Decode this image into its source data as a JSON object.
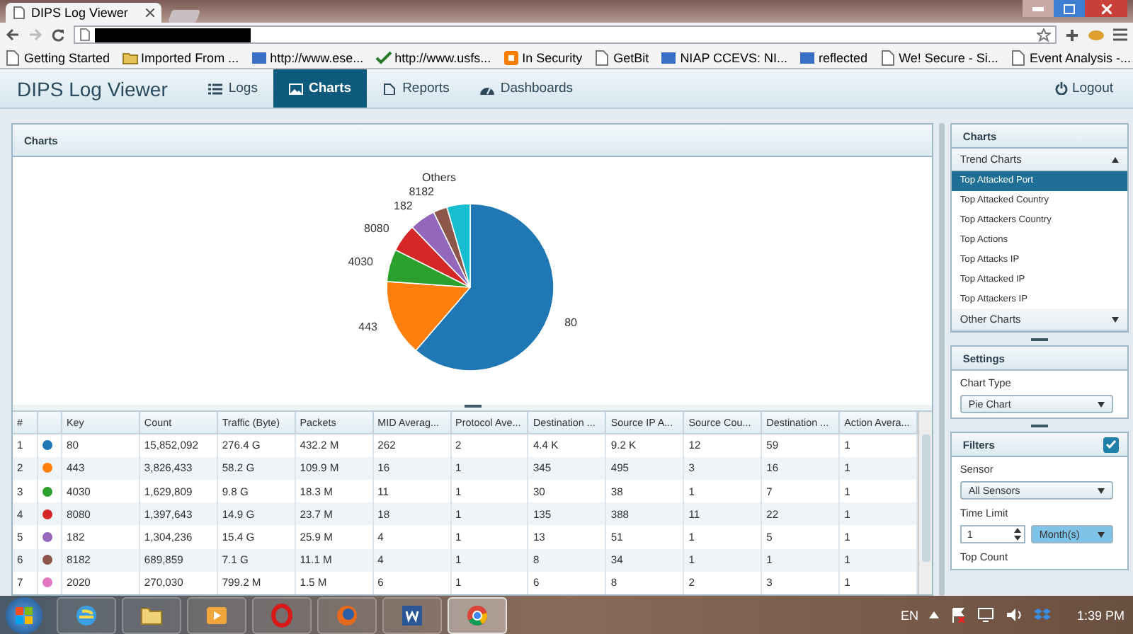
{
  "browser": {
    "tab_title": "DIPS Log Viewer",
    "bookmarks": [
      {
        "label": "Getting Started",
        "kind": "page"
      },
      {
        "label": "Imported From ...",
        "kind": "folder"
      },
      {
        "label": "http://www.ese...",
        "kind": "site"
      },
      {
        "label": "http://www.usfs...",
        "kind": "check"
      },
      {
        "label": "In Security",
        "kind": "blog"
      },
      {
        "label": "GetBit",
        "kind": "page"
      },
      {
        "label": "NIAP CCEVS: NI...",
        "kind": "site"
      },
      {
        "label": "reflected",
        "kind": "site"
      },
      {
        "label": "We! Secure - Si...",
        "kind": "page"
      },
      {
        "label": "Event Analysis -...",
        "kind": "page"
      }
    ]
  },
  "app": {
    "title": "DIPS Log Viewer",
    "nav": [
      {
        "label": "Logs",
        "kind": "list",
        "selected": false
      },
      {
        "label": "Charts",
        "kind": "image",
        "selected": true
      },
      {
        "label": "Reports",
        "kind": "page",
        "selected": false
      },
      {
        "label": "Dashboards",
        "kind": "gauge",
        "selected": false
      }
    ],
    "logout": "Logout"
  },
  "main": {
    "title": "Charts",
    "chart_data": {
      "type": "pie",
      "categories": [
        "80",
        "443",
        "4030",
        "8080",
        "182",
        "8182",
        "Others"
      ],
      "series": [
        {
          "values": [
            61.3,
            14.8,
            6.3,
            5.4,
            5.0,
            2.7,
            4.5
          ]
        }
      ],
      "colors": [
        "#1f77b4",
        "#ff7f0e",
        "#2ca02c",
        "#d62728",
        "#9467bd",
        "#8c564b",
        "#17becf"
      ]
    },
    "table": {
      "columns": [
        "#",
        "Key",
        "Count",
        "Traffic (Byte)",
        "Packets",
        "MID Averag...",
        "Protocol Ave...",
        "Destination ...",
        "Source IP A...",
        "Source Cou...",
        "Destination ...",
        "Action Avera..."
      ],
      "rows": [
        {
          "color": "#1f77b4",
          "cells": [
            "1",
            "80",
            "15,852,092",
            "276.4 G",
            "432.2 M",
            "262",
            "2",
            "4.4 K",
            "9.2 K",
            "12",
            "59",
            "1"
          ]
        },
        {
          "color": "#ff7f0e",
          "cells": [
            "2",
            "443",
            "3,826,433",
            "58.2 G",
            "109.9 M",
            "16",
            "1",
            "345",
            "495",
            "3",
            "16",
            "1"
          ]
        },
        {
          "color": "#2ca02c",
          "cells": [
            "3",
            "4030",
            "1,629,809",
            "9.8 G",
            "18.3 M",
            "11",
            "1",
            "30",
            "38",
            "1",
            "7",
            "1"
          ]
        },
        {
          "color": "#d62728",
          "cells": [
            "4",
            "8080",
            "1,397,643",
            "14.9 G",
            "23.7 M",
            "18",
            "1",
            "135",
            "388",
            "11",
            "22",
            "1"
          ]
        },
        {
          "color": "#9467bd",
          "cells": [
            "5",
            "182",
            "1,304,236",
            "15.4 G",
            "25.9 M",
            "4",
            "1",
            "13",
            "51",
            "1",
            "5",
            "1"
          ]
        },
        {
          "color": "#8c564b",
          "cells": [
            "6",
            "8182",
            "689,859",
            "7.1 G",
            "11.1 M",
            "4",
            "1",
            "8",
            "34",
            "1",
            "1",
            "1"
          ]
        },
        {
          "color": "#e377c2",
          "cells": [
            "7",
            "2020",
            "270,030",
            "799.2 M",
            "1.5 M",
            "6",
            "1",
            "6",
            "8",
            "2",
            "3",
            "1"
          ]
        }
      ]
    }
  },
  "sidebar": {
    "title": "Charts",
    "groups": [
      {
        "label": "Trend Charts",
        "expanded": true,
        "items": [
          {
            "label": "Top Attacked Port",
            "selected": true
          },
          {
            "label": "Top Attacked Country",
            "selected": false
          },
          {
            "label": "Top Attackers Country",
            "selected": false
          },
          {
            "label": "Top Actions",
            "selected": false
          },
          {
            "label": "Top Attacks IP",
            "selected": false
          },
          {
            "label": "Top Attacked IP",
            "selected": false
          },
          {
            "label": "Top Attackers IP",
            "selected": false
          }
        ]
      },
      {
        "label": "Other Charts",
        "expanded": false
      }
    ],
    "settings": {
      "title": "Settings",
      "chart_type_label": "Chart Type",
      "chart_type": "Pie Chart"
    },
    "filters": {
      "title": "Filters",
      "checked": true,
      "sensor_label": "Sensor",
      "sensor": "All Sensors",
      "time_limit_label": "Time Limit",
      "time_value": "1",
      "time_unit": "Month(s)",
      "top_count_label": "Top Count"
    }
  },
  "taskbar": {
    "apps": [
      {
        "kind": "ie",
        "selected": false
      },
      {
        "kind": "folder",
        "selected": false
      },
      {
        "kind": "media",
        "selected": false
      },
      {
        "kind": "opera",
        "selected": false
      },
      {
        "kind": "firefox",
        "selected": false
      },
      {
        "kind": "word",
        "selected": false
      },
      {
        "kind": "chrome",
        "selected": true
      }
    ],
    "language": "EN",
    "time": "1:39 PM"
  }
}
